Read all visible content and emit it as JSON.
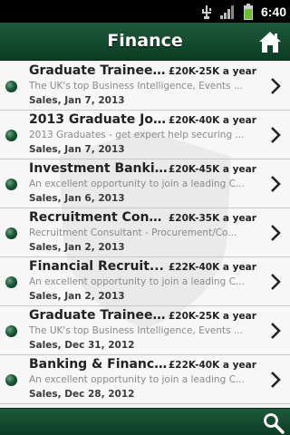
{
  "status_bar": {
    "time": "6:40",
    "icons": [
      "usb-icon",
      "signal-icon",
      "battery-icon"
    ]
  },
  "header": {
    "title": "Finance",
    "home_icon": "home-icon"
  },
  "colors": {
    "brand_green": "#0c3d24",
    "accent_green": "#1d5a3b"
  },
  "jobs": [
    {
      "title": "Graduate Trainee ...",
      "salary": "£20K-25K a year",
      "snippet": "The UK's top Business Intelligence, Events ...",
      "meta": "Sales, Jan 7, 2013"
    },
    {
      "title": "2013 Graduate Job...",
      "salary": "£20K-40K a year",
      "snippet": "2013 Graduates - get expert help securing ...",
      "meta": "Sales, Jan 7, 2013"
    },
    {
      "title": "Investment Banki...",
      "salary": "£20K-45K a year",
      "snippet": "An excellent opportunity to join a leading C...",
      "meta": "Sales, Jan 6, 2013"
    },
    {
      "title": "Recruitment Cons...",
      "salary": "£20K-35K a year",
      "snippet": "Recruitment Consultant - Procurement/Co...",
      "meta": "Sales, Jan 2, 2013"
    },
    {
      "title": "Financial Recruit...",
      "salary": "£22K-40K a year",
      "snippet": "An excellent opportunity to join a leading C...",
      "meta": "Sales, Jan 2, 2013"
    },
    {
      "title": "Graduate Trainee ...",
      "salary": "£20K-25K a year",
      "snippet": "The UK's top Business Intelligence, Events ...",
      "meta": "Sales, Dec 31, 2012"
    },
    {
      "title": "Banking & Financ...",
      "salary": "£22K-40K a year",
      "snippet": "An excellent opportunity to join a leading C...",
      "meta": "Sales, Dec 28, 2012"
    }
  ],
  "bottom_bar": {
    "search_icon": "search-icon"
  }
}
